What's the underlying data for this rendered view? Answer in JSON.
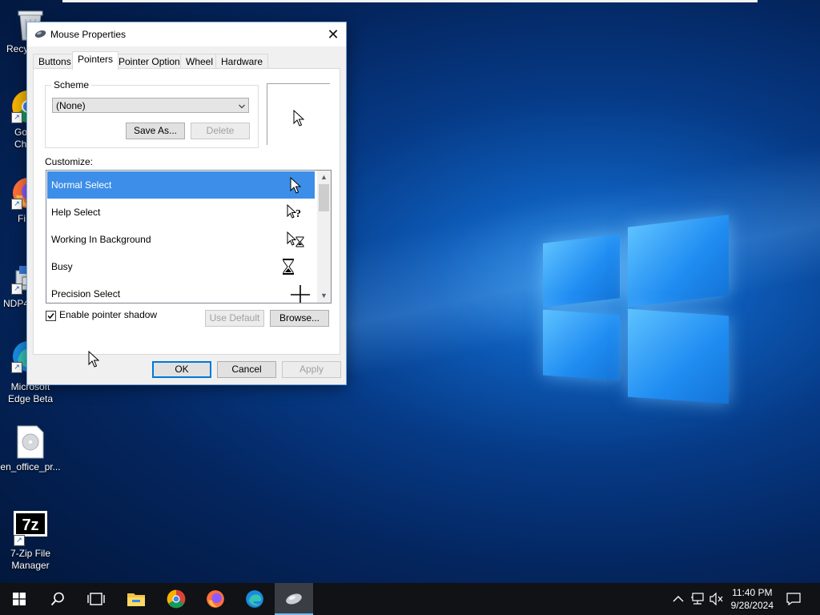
{
  "desktop": {
    "icons": [
      {
        "label": "Recy"
      },
      {
        "label": "Go\nCh"
      },
      {
        "label": "Fi"
      },
      {
        "label": "NDP4"
      },
      {
        "label": "Microsoft\nEdge Beta"
      },
      {
        "label": "en_office_pr..."
      },
      {
        "label": "7-Zip File\nManager"
      }
    ]
  },
  "dialog": {
    "title": "Mouse Properties",
    "close_glyph": "✕",
    "tabs": [
      "Buttons",
      "Pointers",
      "Pointer Options",
      "Wheel",
      "Hardware"
    ],
    "active_tab": "Pointers",
    "scheme": {
      "legend": "Scheme",
      "value": "(None)",
      "save_as": "Save As...",
      "delete": "Delete"
    },
    "customize_label": "Customize:",
    "pointers": [
      {
        "name": "Normal Select",
        "icon": "arrow-cursor-icon",
        "selected": true
      },
      {
        "name": "Help Select",
        "icon": "help-cursor-icon",
        "selected": false
      },
      {
        "name": "Working In Background",
        "icon": "working-cursor-icon",
        "selected": false
      },
      {
        "name": "Busy",
        "icon": "hourglass-cursor-icon",
        "selected": false
      },
      {
        "name": "Precision Select",
        "icon": "crosshair-cursor-icon",
        "selected": false
      }
    ],
    "shadow": {
      "label": "Enable pointer shadow",
      "checked": true
    },
    "use_default": "Use Default",
    "browse": "Browse...",
    "ok": "OK",
    "cancel": "Cancel",
    "apply": "Apply"
  },
  "taskbar": {
    "time": "11:40 PM",
    "date": "9/28/2024"
  },
  "colors": {
    "selection": "#3d8ee8",
    "accent": "#0078d7",
    "taskbar": "#101216"
  }
}
